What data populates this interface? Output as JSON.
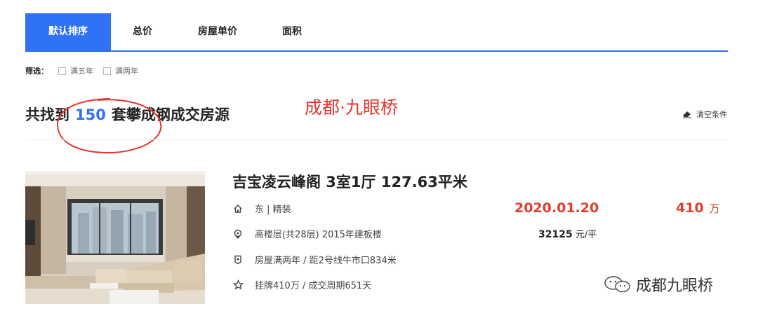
{
  "tabs": [
    {
      "label": "默认排序",
      "active": true
    },
    {
      "label": "总价"
    },
    {
      "label": "房屋单价"
    },
    {
      "label": "面积"
    }
  ],
  "filter": {
    "label": "筛选：",
    "options": [
      "满五年",
      "满两年"
    ]
  },
  "result": {
    "prefix": "共找到",
    "count": "150",
    "suffix": "套攀成钢成交房源"
  },
  "annotation": {
    "title": "成都·九眼桥"
  },
  "clear_label": "清空条件",
  "listing": {
    "title": "吉宝凌云峰阁 3室1厅 127.63平米",
    "orientation": "东 | 精装",
    "floor": "高楼层(共28层) 2015年建板楼",
    "tags": "房屋满两年 / 距2号线牛市口834米",
    "listing_info": "挂牌410万 / 成交周期651天",
    "deal_date": "2020.01.20",
    "unit_price_value": "32125",
    "unit_price_suffix": "元/平",
    "total_price": "410",
    "total_unit": "万"
  },
  "watermark": "成都九眼桥",
  "colors": {
    "accent": "#3072f6",
    "price_red": "#e0402d",
    "annotation_red": "#e6352a"
  }
}
